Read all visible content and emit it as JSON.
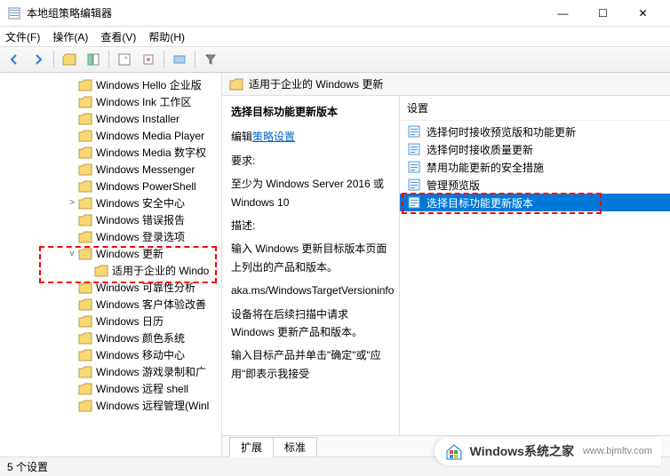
{
  "window": {
    "title": "本地组策略编辑器",
    "controls": {
      "min": "—",
      "max": "☐",
      "close": "✕"
    }
  },
  "menu": {
    "file": "文件(F)",
    "action": "操作(A)",
    "view": "查看(V)",
    "help": "帮助(H)"
  },
  "tree": {
    "items": [
      {
        "label": "Windows Hello 企业版",
        "indent": 72
      },
      {
        "label": "Windows Ink 工作区",
        "indent": 72
      },
      {
        "label": "Windows Installer",
        "indent": 72
      },
      {
        "label": "Windows Media Player",
        "indent": 72
      },
      {
        "label": "Windows Media 数字权",
        "indent": 72
      },
      {
        "label": "Windows Messenger",
        "indent": 72
      },
      {
        "label": "Windows PowerShell",
        "indent": 72
      },
      {
        "label": "Windows 安全中心",
        "indent": 72,
        "expander": ">"
      },
      {
        "label": "Windows 错误报告",
        "indent": 72
      },
      {
        "label": "Windows 登录选项",
        "indent": 72
      },
      {
        "label": "Windows 更新",
        "indent": 72,
        "expander": "v",
        "hl": true
      },
      {
        "label": "适用于企业的 Windo",
        "indent": 90,
        "hl": true
      },
      {
        "label": "Windows 可靠性分析",
        "indent": 72
      },
      {
        "label": "Windows 客户体验改善",
        "indent": 72
      },
      {
        "label": "Windows 日历",
        "indent": 72
      },
      {
        "label": "Windows 颜色系统",
        "indent": 72
      },
      {
        "label": "Windows 移动中心",
        "indent": 72
      },
      {
        "label": "Windows 游戏录制和广",
        "indent": 72
      },
      {
        "label": "Windows 远程 shell",
        "indent": 72
      },
      {
        "label": "Windows 远程管理(Winl",
        "indent": 72
      }
    ]
  },
  "content": {
    "header": "适用于企业的 Windows 更新",
    "detail": {
      "title": "选择目标功能更新版本",
      "editLabel": "编辑",
      "linkText": "策略设置",
      "reqHeading": "要求:",
      "requirement": "至少为 Windows Server 2016 或 Windows 10",
      "descHeading": "描述:",
      "desc1": "输入 Windows 更新目标版本页面上列出的产品和版本。",
      "desc2": "aka.ms/WindowsTargetVersioninfo",
      "desc3": "设备将在后续扫描中请求 Windows 更新产品和版本。",
      "desc4": "输入目标产品并单击\"确定\"或\"应用\"即表示我接受"
    },
    "settingsHeader": "设置",
    "settings": [
      {
        "label": "选择何时接收预览版和功能更新"
      },
      {
        "label": "选择何时接收质量更新"
      },
      {
        "label": "禁用功能更新的安全措施"
      },
      {
        "label": "管理预览版"
      },
      {
        "label": "选择目标功能更新版本",
        "selected": true,
        "hl": true
      }
    ]
  },
  "tabs": {
    "extended": "扩展",
    "standard": "标准"
  },
  "status": "5 个设置",
  "watermark": {
    "brand": "Windows系统之家",
    "url": "www.bjmltv.com"
  },
  "icons": {
    "folder_fill": "#F8D775",
    "folder_stroke": "#C09945",
    "setting_fill": "#E8F4FD",
    "setting_stroke": "#5B9BD5"
  }
}
